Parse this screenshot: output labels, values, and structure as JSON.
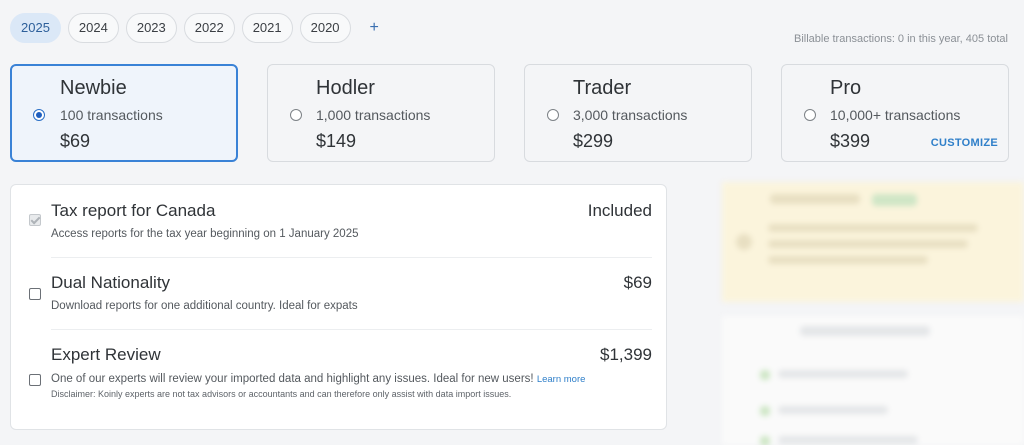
{
  "years": [
    "2025",
    "2024",
    "2023",
    "2022",
    "2021",
    "2020"
  ],
  "add_year_label": "+",
  "billable_text": "Billable transactions: 0 in this year, 405 total",
  "plans": [
    {
      "name": "Newbie",
      "transactions": "100 transactions",
      "price": "$69"
    },
    {
      "name": "Hodler",
      "transactions": "1,000 transactions",
      "price": "$149"
    },
    {
      "name": "Trader",
      "transactions": "3,000 transactions",
      "price": "$299"
    },
    {
      "name": "Pro",
      "transactions": "10,000+ transactions",
      "price": "$399"
    }
  ],
  "customize_label": "CUSTOMIZE",
  "options": {
    "tax_report": {
      "title": "Tax report for Canada",
      "price": "Included",
      "description": "Access reports for the tax year beginning on 1 January 2025"
    },
    "dual_nationality": {
      "title": "Dual Nationality",
      "price": "$69",
      "description": "Download reports for one additional country. Ideal for expats"
    },
    "expert_review": {
      "title": "Expert Review",
      "price": "$1,399",
      "description": "One of our experts will review your imported data and highlight any issues. Ideal for new users!",
      "learn_more": "Learn more",
      "disclaimer": "Disclaimer: Koinly experts are not tax advisors or accountants and can therefore only assist with data import issues."
    }
  },
  "colors": {
    "accent": "#3a82d6",
    "link": "#2f7fc9",
    "active_year_bg": "#dbe8f7"
  }
}
